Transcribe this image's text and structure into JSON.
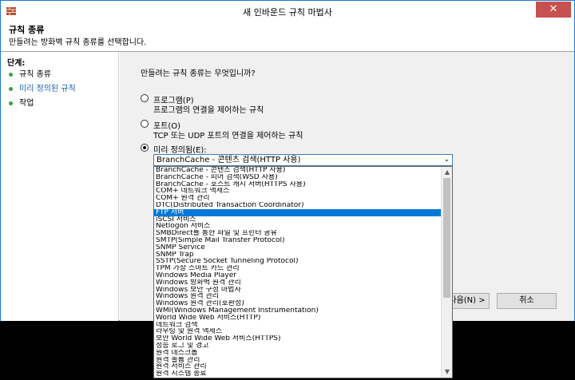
{
  "window": {
    "title": "새 인바운드 규칙 마법사",
    "close_glyph": "✕"
  },
  "header": {
    "title": "규칙 종류",
    "subtitle": "만들려는 방화벽 규칙 종류를 선택합니다."
  },
  "steps": {
    "title": "단계:",
    "items": [
      {
        "label": "규칙 종류"
      },
      {
        "label": "미리 정의된 규칙"
      },
      {
        "label": "작업"
      }
    ]
  },
  "main": {
    "question": "만들려는 규칙 종류는 무엇입니까?",
    "options": [
      {
        "label": "프로그램(P)",
        "desc": "프로그램의 연결을 제어하는 규칙",
        "checked": false
      },
      {
        "label": "포트(O)",
        "desc": "TCP 또는 UDP 포트의 연결을 제어하는 규칙",
        "checked": false
      },
      {
        "label": "미리 정의됨(E):",
        "desc": "",
        "checked": true
      }
    ],
    "combo_value": "BranchCache - 콘텐츠 검색(HTTP 사용)",
    "next_label": "다음(N) >",
    "cancel_label": "취소"
  },
  "dropdown": {
    "selected_index": 6,
    "items": [
      "BranchCache - 콘텐츠 검색(HTTP 사용)",
      "BranchCache - 피어 검색(WSD 사용)",
      "BranchCache - 호스트 캐시 서버(HTTPS 사용)",
      "COM+ 네트워크 액세스",
      "COM+ 원격 관리",
      "DTC(Distributed Transaction Coordinator)",
      "FTP 서버",
      "iSCSI 서비스",
      "Netlogon 서비스",
      "SMBDirect를 통한 파일 및 프린터 공유",
      "SMTP(Simple Mail Transfer Protocol)",
      "SNMP Service",
      "SNMP Trap",
      "SSTP(Secure Socket Tunneling Protocol)",
      "TPM 가상 스마트 카드 관리",
      "Windows Media Player",
      "Windows 방화벽 원격 관리",
      "Windows 보안 구성 마법사",
      "Windows 원격 관리",
      "Windows 원격 관리(호환성)",
      "WMI(Windows Management Instrumentation)",
      "World Wide Web 서비스(HTTP)",
      "네트워크 검색",
      "라우팅 및 원격 액세스",
      "보안 World Wide Web 서비스(HTTPS)",
      "성능 로그 및 경고",
      "원격 데스크톱",
      "원격 볼륨 관리",
      "원격 서비스 관리",
      "원격 시스템 종료"
    ]
  },
  "colors": {
    "accent": "#0078d7",
    "step_done": "#3aa33a",
    "step_active": "#1c5fb0",
    "close_button": "#c75050"
  }
}
